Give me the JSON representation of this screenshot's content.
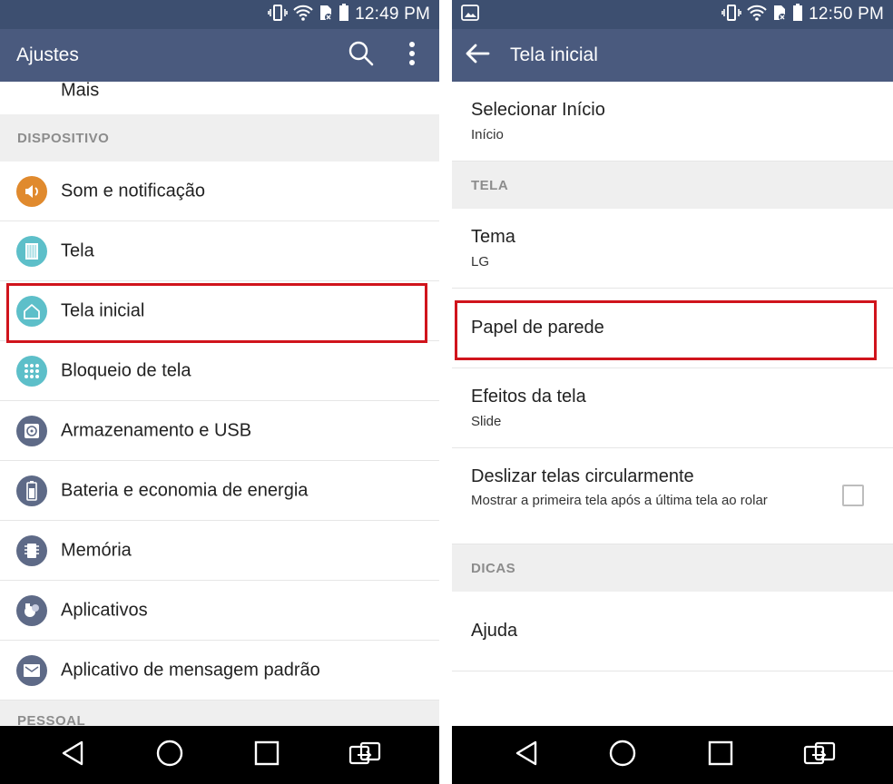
{
  "left": {
    "status": {
      "time": "12:49 PM"
    },
    "appbar": {
      "title": "Ajustes"
    },
    "partial_top_item": "Mais",
    "section_device": "DISPOSITIVO",
    "items": [
      {
        "label": "Som e notificação",
        "icon": "speaker-icon",
        "color": "#e08a2e"
      },
      {
        "label": "Tela",
        "icon": "display-icon",
        "color": "#5dbfc9"
      },
      {
        "label": "Tela inicial",
        "icon": "home-icon",
        "color": "#5dbfc9"
      },
      {
        "label": "Bloqueio de tela",
        "icon": "lock-grid-icon",
        "color": "#5dbfc9"
      },
      {
        "label": "Armazenamento e USB",
        "icon": "storage-icon",
        "color": "#5e6a87"
      },
      {
        "label": "Bateria e economia de energia",
        "icon": "battery-icon",
        "color": "#5e6a87"
      },
      {
        "label": "Memória",
        "icon": "memory-chip-icon",
        "color": "#5e6a87"
      },
      {
        "label": "Aplicativos",
        "icon": "apps-icon",
        "color": "#5e6a87"
      },
      {
        "label": "Aplicativo de mensagem padrão",
        "icon": "message-icon",
        "color": "#5e6a87"
      }
    ],
    "section_personal": "PESSOAL"
  },
  "right": {
    "status": {
      "time": "12:50 PM"
    },
    "appbar": {
      "title": "Tela inicial"
    },
    "select_home": {
      "title": "Selecionar Início",
      "summary": "Início"
    },
    "section_screen": "TELA",
    "theme": {
      "title": "Tema",
      "summary": "LG"
    },
    "wallpaper": {
      "title": "Papel de parede"
    },
    "screen_effects": {
      "title": "Efeitos da tela",
      "summary": "Slide"
    },
    "circular_scroll": {
      "title": "Deslizar telas circularmente",
      "summary": "Mostrar a primeira tela após a última tela ao rolar",
      "checked": false
    },
    "section_tips": "DICAS",
    "help": {
      "title": "Ajuda"
    }
  },
  "colors": {
    "statusbar": "#3d4f70",
    "appbar": "#4a5a7e",
    "highlight": "#d0141c",
    "section_bg": "#efefef"
  }
}
